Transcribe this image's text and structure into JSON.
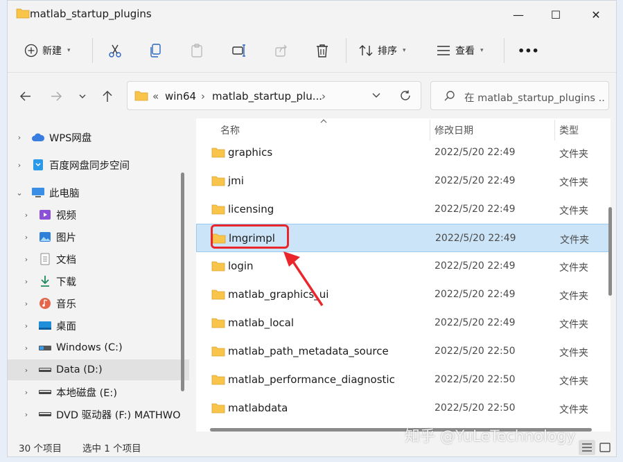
{
  "window": {
    "title": "matlab_startup_plugins",
    "controls": {
      "minimize": "—",
      "maximize": "☐",
      "close": "✕"
    }
  },
  "toolbar": {
    "new_label": "新建",
    "sort_label": "排序",
    "view_label": "查看",
    "more_label": "•••"
  },
  "address": {
    "overflow": "«",
    "segments": [
      "win64",
      "matlab_startup_plu..."
    ],
    "separator": "›"
  },
  "search": {
    "placeholder": "在 matlab_startup_plugins ..."
  },
  "sidebar": {
    "items": [
      {
        "label": "WPS网盘",
        "icon": "cloud-icon"
      },
      {
        "label": "百度网盘同步空间",
        "icon": "baidu-drive-icon"
      },
      {
        "label": "此电脑",
        "icon": "computer-icon"
      },
      {
        "label": "视频",
        "icon": "video-icon"
      },
      {
        "label": "图片",
        "icon": "pictures-icon"
      },
      {
        "label": "文档",
        "icon": "documents-icon"
      },
      {
        "label": "下载",
        "icon": "download-icon"
      },
      {
        "label": "音乐",
        "icon": "music-icon"
      },
      {
        "label": "桌面",
        "icon": "desktop-icon"
      },
      {
        "label": "Windows (C:)",
        "icon": "windows-drive-icon"
      },
      {
        "label": "Data (D:)",
        "icon": "drive-icon"
      },
      {
        "label": "本地磁盘 (E:)",
        "icon": "drive-icon"
      },
      {
        "label": "DVD 驱动器 (F:) MATHWO",
        "icon": "dvd-drive-icon"
      }
    ]
  },
  "columns": {
    "name": "名称",
    "date": "修改日期",
    "type": "类型"
  },
  "files": [
    {
      "name": "graphics",
      "date": "2022/5/20 22:49",
      "type": "文件夹"
    },
    {
      "name": "jmi",
      "date": "2022/5/20 22:49",
      "type": "文件夹"
    },
    {
      "name": "licensing",
      "date": "2022/5/20 22:49",
      "type": "文件夹"
    },
    {
      "name": "lmgrimpl",
      "date": "2022/5/20 22:49",
      "type": "文件夹"
    },
    {
      "name": "login",
      "date": "2022/5/20 22:49",
      "type": "文件夹"
    },
    {
      "name": "matlab_graphics_ui",
      "date": "2022/5/20 22:49",
      "type": "文件夹"
    },
    {
      "name": "matlab_local",
      "date": "2022/5/20 22:49",
      "type": "文件夹"
    },
    {
      "name": "matlab_path_metadata_source",
      "date": "2022/5/20 22:50",
      "type": "文件夹"
    },
    {
      "name": "matlab_performance_diagnostic",
      "date": "2022/5/20 22:50",
      "type": "文件夹"
    },
    {
      "name": "matlabdata",
      "date": "2022/5/20 22:50",
      "type": "文件夹"
    }
  ],
  "status": {
    "count": "30 个项目",
    "selected": "选中 1 个项目"
  },
  "watermark": "知乎 @YuLeTechnology",
  "colors": {
    "folder": "#f8c44a",
    "selection": "#cce4f7",
    "annotation": "#e8262b"
  }
}
